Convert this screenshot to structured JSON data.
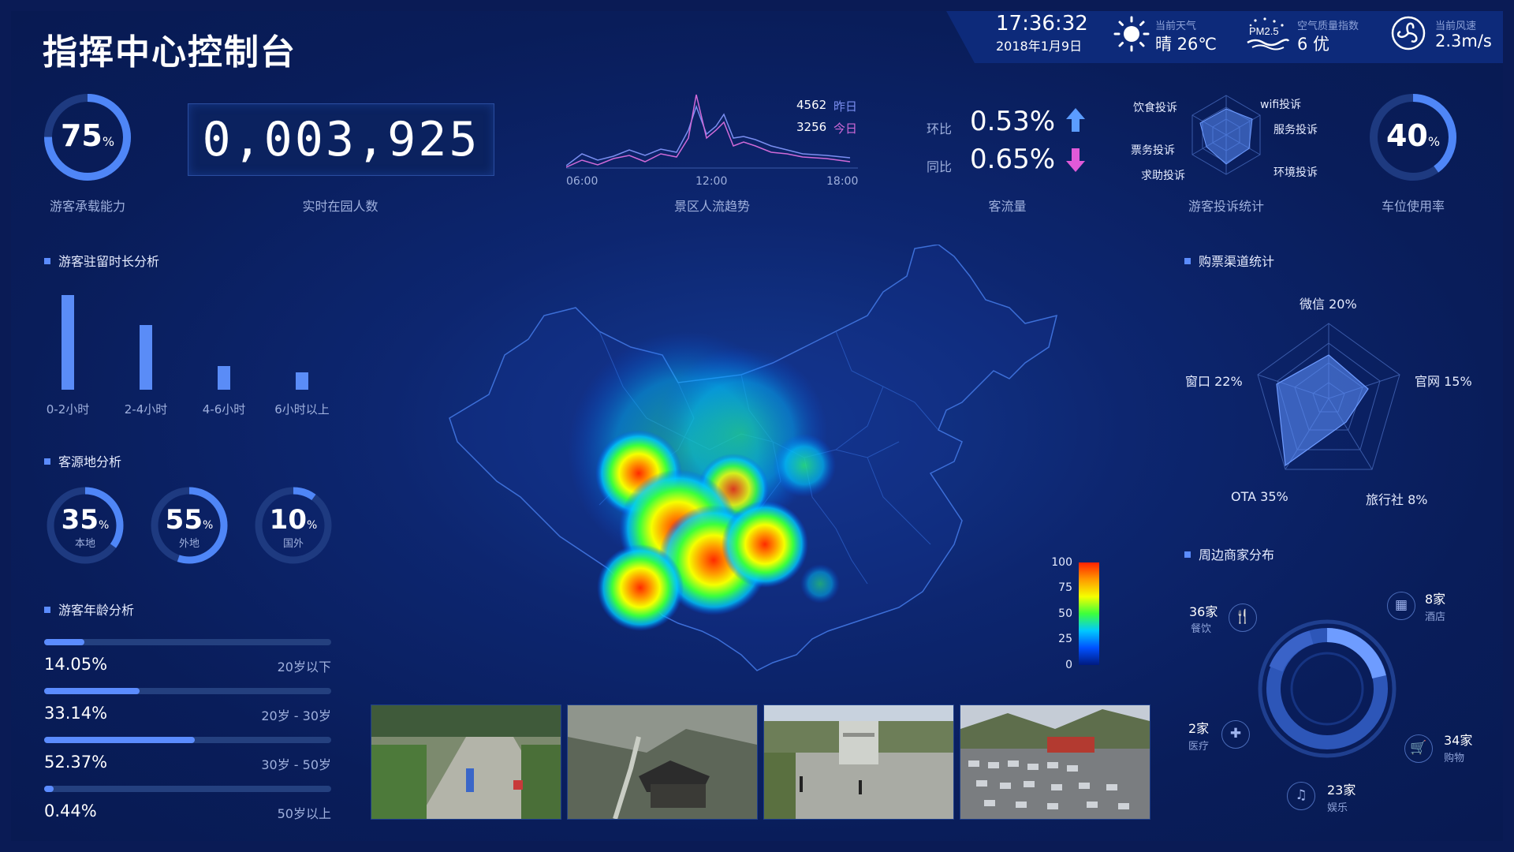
{
  "header": {
    "title": "指挥中心控制台",
    "time": "17:36:32",
    "date": "2018年1月9日",
    "weather": {
      "label": "当前天气",
      "value": "晴 26℃",
      "icon": "sun-icon"
    },
    "air": {
      "label": "空气质量指数",
      "value": "6 优",
      "badge": "PM2.5",
      "icon": "air-quality-icon"
    },
    "wind": {
      "label": "当前风速",
      "value": "2.3m/s",
      "icon": "wind-icon"
    }
  },
  "kpis": {
    "capacity": {
      "pct": "75",
      "unit": "%",
      "label": "游客承载能力",
      "fraction": 0.75
    },
    "visitors": {
      "value": "0,003,925",
      "label": "实时在园人数"
    },
    "trend": {
      "label": "景区人流趋势",
      "yesterday_value": "4562",
      "yesterday_label": "昨日",
      "today_value": "3256",
      "today_label": "今日",
      "ticks": [
        "06:00",
        "12:00",
        "18:00"
      ]
    },
    "flow": {
      "label": "客流量",
      "mom_label": "环比",
      "mom_value": "0.53%",
      "yoy_label": "同比",
      "yoy_value": "0.65%"
    },
    "complaints": {
      "label": "游客投诉统计",
      "items": [
        "饮食投诉",
        "wifi投诉",
        "服务投诉",
        "环境投诉",
        "求助投诉",
        "票务投诉"
      ]
    },
    "parking": {
      "pct": "40",
      "unit": "%",
      "label": "车位使用率",
      "fraction": 0.4
    }
  },
  "stay": {
    "title": "游客驻留时长分析",
    "items": [
      {
        "label": "0-2小时",
        "value": 100
      },
      {
        "label": "2-4小时",
        "value": 68
      },
      {
        "label": "4-6小时",
        "value": 25
      },
      {
        "label": "6小时以上",
        "value": 18
      }
    ]
  },
  "origin": {
    "title": "客源地分析",
    "items": [
      {
        "pct": "35",
        "label": "本地",
        "fraction": 0.35
      },
      {
        "pct": "55",
        "label": "外地",
        "fraction": 0.55
      },
      {
        "pct": "10",
        "label": "国外",
        "fraction": 0.1
      }
    ]
  },
  "age": {
    "title": "游客年龄分析",
    "items": [
      {
        "pct": "14.05%",
        "label": "20岁以下",
        "fraction": 0.1405
      },
      {
        "pct": "33.14%",
        "label": "20岁 - 30岁",
        "fraction": 0.3314
      },
      {
        "pct": "52.37%",
        "label": "30岁 - 50岁",
        "fraction": 0.5237
      },
      {
        "pct": "0.44%",
        "label": "50岁以上",
        "fraction": 0.0044
      }
    ]
  },
  "heatmap_legend": {
    "ticks": [
      "100",
      "75",
      "50",
      "25",
      "0"
    ]
  },
  "channels": {
    "title": "购票渠道统计",
    "items": [
      "微信 20%",
      "官网 15%",
      "旅行社 8%",
      "OTA 35%",
      "窗口 22%"
    ]
  },
  "merchants": {
    "title": "周边商家分布",
    "items": [
      {
        "count": "36家",
        "cat": "餐饮",
        "icon": "dining-icon"
      },
      {
        "count": "8家",
        "cat": "酒店",
        "icon": "hotel-icon"
      },
      {
        "count": "34家",
        "cat": "购物",
        "icon": "shopping-cart-icon"
      },
      {
        "count": "23家",
        "cat": "娱乐",
        "icon": "entertainment-icon"
      },
      {
        "count": "2家",
        "cat": "医疗",
        "icon": "medical-icon"
      }
    ]
  },
  "colors": {
    "accent": "#5b8cff",
    "up": "#5b9cff",
    "down": "#e05ad8",
    "bg": "#0a1b55"
  }
}
